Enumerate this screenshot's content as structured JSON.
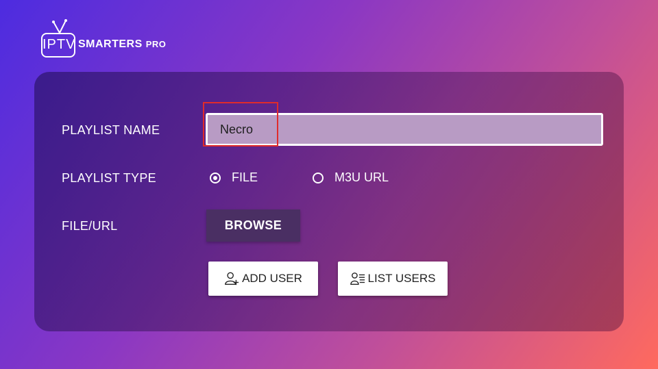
{
  "brand": {
    "iptv": "IPTV",
    "name": "SMARTERS",
    "pro": "PRO"
  },
  "form": {
    "playlist_name_label": "PLAYLIST NAME",
    "playlist_name_value": "Necro",
    "playlist_type_label": "PLAYLIST TYPE",
    "type_options": [
      {
        "label": "FILE",
        "selected": true
      },
      {
        "label": "M3U URL",
        "selected": false
      }
    ],
    "file_url_label": "FILE/URL",
    "browse_label": "BROWSE"
  },
  "actions": {
    "add_user_label": "ADD USER",
    "add_user_icon": "add-user-icon",
    "list_users_label": "LIST USERS",
    "list_users_icon": "list-users-icon"
  },
  "colors": {
    "highlight": "#e02b2b",
    "background_start": "#4d2ce0",
    "background_end": "#ff6a5e"
  }
}
